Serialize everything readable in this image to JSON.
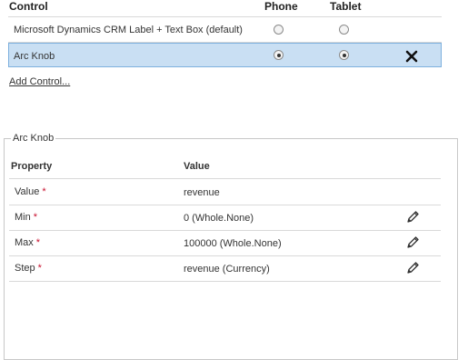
{
  "controls_table": {
    "headers": {
      "control": "Control",
      "phone": "Phone",
      "tablet": "Tablet"
    },
    "rows": [
      {
        "label": "Microsoft Dynamics CRM Label + Text Box (default)",
        "phone_checked": false,
        "tablet_checked": false,
        "selected": false
      },
      {
        "label": "Arc Knob",
        "phone_checked": true,
        "tablet_checked": true,
        "selected": true
      }
    ],
    "add_control_label": "Add Control..."
  },
  "properties_panel": {
    "title": "Arc Knob",
    "headers": {
      "property": "Property",
      "value": "Value"
    },
    "required_marker": "*",
    "rows": [
      {
        "property": "Value",
        "value": "revenue",
        "editable": false
      },
      {
        "property": "Min",
        "value": "0 (Whole.None)",
        "editable": true
      },
      {
        "property": "Max",
        "value": "100000 (Whole.None)",
        "editable": true
      },
      {
        "property": "Step",
        "value": "revenue (Currency)",
        "editable": true
      }
    ]
  },
  "icons": {
    "remove": "close-x-icon",
    "edit": "pencil-icon"
  },
  "colors": {
    "selected_bg": "#c9dff3",
    "selected_border": "#7db0de",
    "required": "#c8102e"
  }
}
